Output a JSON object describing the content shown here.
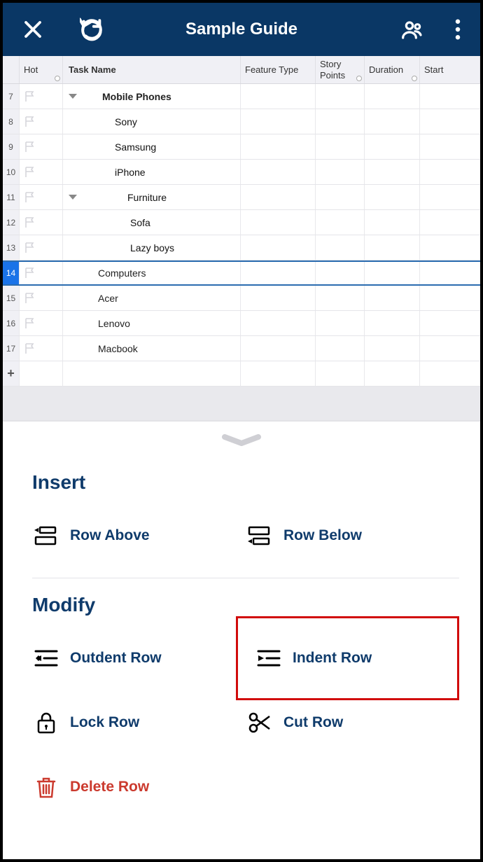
{
  "header": {
    "title": "Sample Guide"
  },
  "columns": {
    "hot": "Hot",
    "task": "Task Name",
    "feature": "Feature Type",
    "story": "Story Points",
    "duration": "Duration",
    "start": "Start"
  },
  "rows": [
    {
      "num": "7",
      "name": "Mobile Phones",
      "level": 0,
      "expander": true
    },
    {
      "num": "8",
      "name": "Sony",
      "level": 1
    },
    {
      "num": "9",
      "name": "Samsung",
      "level": 1
    },
    {
      "num": "10",
      "name": "iPhone",
      "level": 1
    },
    {
      "num": "11",
      "name": "Furniture",
      "level": 1,
      "expander": true
    },
    {
      "num": "12",
      "name": "Sofa",
      "level": 2
    },
    {
      "num": "13",
      "name": "Lazy boys",
      "level": 2
    },
    {
      "num": "14",
      "name": "Computers",
      "level": 0,
      "selected": true,
      "noBold": true
    },
    {
      "num": "15",
      "name": "Acer",
      "level": 0,
      "noBold": true
    },
    {
      "num": "16",
      "name": "Lenovo",
      "level": 0,
      "noBold": true
    },
    {
      "num": "17",
      "name": "Macbook",
      "level": 0,
      "noBold": true
    }
  ],
  "addRow": "+",
  "sheet": {
    "insertTitle": "Insert",
    "modifyTitle": "Modify",
    "actions": {
      "rowAbove": "Row Above",
      "rowBelow": "Row Below",
      "outdent": "Outdent Row",
      "indent": "Indent Row",
      "lock": "Lock Row",
      "cut": "Cut Row",
      "delete": "Delete Row"
    }
  }
}
